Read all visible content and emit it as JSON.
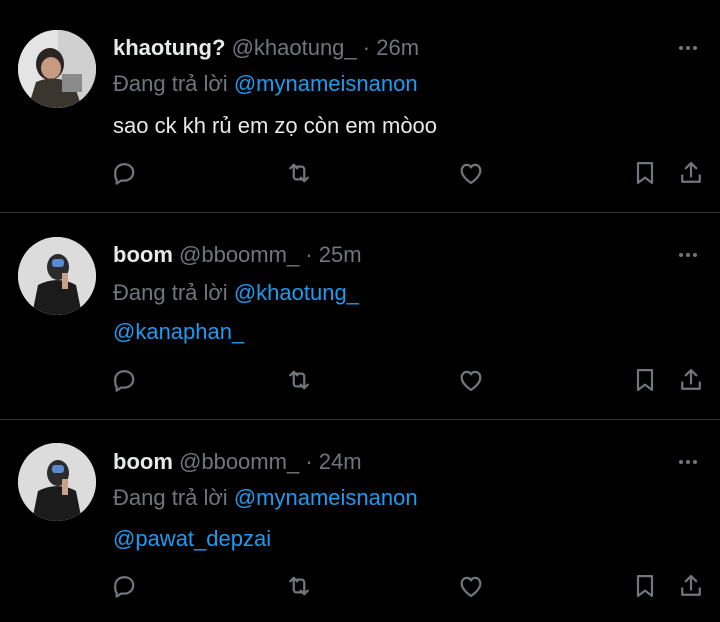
{
  "tweets": [
    {
      "name": "khaotung?",
      "handle": "@khaotung_",
      "dot": "·",
      "time": "26m",
      "reply_prefix": "Đang trả lời",
      "reply_to": "@mynameisnanon",
      "text": "sao ck kh rủ em zọ còn em mòoo",
      "text_is_link": false
    },
    {
      "name": "boom",
      "handle": "@bboomm_",
      "dot": "·",
      "time": "25m",
      "reply_prefix": "Đang trả lời",
      "reply_to": "@khaotung_",
      "text": "@kanaphan_",
      "text_is_link": true
    },
    {
      "name": "boom",
      "handle": "@bboomm_",
      "dot": "·",
      "time": "24m",
      "reply_prefix": "Đang trả lời",
      "reply_to": "@mynameisnanon",
      "text": "@pawat_depzai",
      "text_is_link": true
    }
  ],
  "icons": {
    "reply": "reply-icon",
    "retweet": "retweet-icon",
    "like": "heart-icon",
    "bookmark": "bookmark-icon",
    "share": "share-icon",
    "more": "more-horizontal-icon"
  },
  "colors": {
    "background": "#000000",
    "text": "#e7e9ea",
    "muted": "#71767b",
    "link": "#1d9bf0",
    "divider": "#2f3336"
  }
}
